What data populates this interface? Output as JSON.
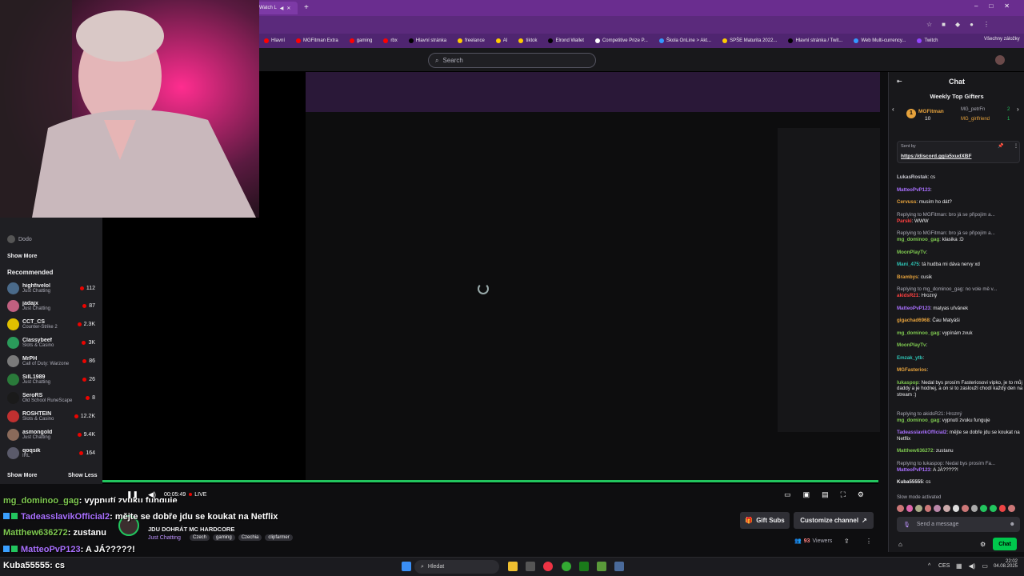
{
  "browser": {
    "tab_title": "Watch L",
    "bookmarks": [
      {
        "label": "Hlavní",
        "color": "#ff0000"
      },
      {
        "label": "MGFitman Extra",
        "color": "#ff0000"
      },
      {
        "label": "gaming",
        "color": "#ff0000"
      },
      {
        "label": "rbx",
        "color": "#ff0000"
      },
      {
        "label": "Hlavní stránka",
        "color": "#000000"
      },
      {
        "label": "freelance",
        "color": "#ffcc00"
      },
      {
        "label": "AI",
        "color": "#ffcc00"
      },
      {
        "label": "tiktok",
        "color": "#ffcc00"
      },
      {
        "label": "Elrond Wallet",
        "color": "#000000"
      },
      {
        "label": "Competitive Prize P...",
        "color": "#ffffff"
      },
      {
        "label": "Škola OnLine > Akt...",
        "color": "#3399ff"
      },
      {
        "label": "SPŠE Maturita 2022...",
        "color": "#ffcc00"
      },
      {
        "label": "Hlavní stránka / Twit...",
        "color": "#000000"
      },
      {
        "label": "Web Multi-currency...",
        "color": "#3399ff"
      },
      {
        "label": "Twitch",
        "color": "#9146ff"
      }
    ],
    "all_bookmarks": "Všechny záložky"
  },
  "topnav": {
    "search_placeholder": "Search"
  },
  "sidebar": {
    "channels_top": [
      {
        "name": "Dodo"
      }
    ],
    "show_more": "Show More",
    "recommended_title": "Recommended",
    "recommended": [
      {
        "name": "highfivelol",
        "game": "Just Chatting",
        "viewers": "112",
        "color": "#4a6a8a"
      },
      {
        "name": "jadajx",
        "game": "Just Chatting",
        "viewers": "87",
        "color": "#c06080"
      },
      {
        "name": "CCT_CS",
        "game": "Counter-Strike 2",
        "viewers": "2.3K",
        "color": "#e0c000"
      },
      {
        "name": "Classybeef",
        "game": "Slots & Casino",
        "viewers": "3K",
        "color": "#2a9a5a"
      },
      {
        "name": "MrPH",
        "game": "Call of Duty: Warzone",
        "viewers": "86",
        "color": "#7a7a7a"
      },
      {
        "name": "SilL1989",
        "game": "Just Chatting",
        "viewers": "26",
        "color": "#2a7a3a"
      },
      {
        "name": "SeroRS",
        "game": "Old School RuneScape",
        "viewers": "8",
        "color": "#1a1a1a"
      },
      {
        "name": "ROSHTEIN",
        "game": "Slots & Casino",
        "viewers": "12.2K",
        "color": "#c03030"
      },
      {
        "name": "asmongold",
        "game": "Just Chatting",
        "viewers": "9.4K",
        "color": "#8a6a5a"
      },
      {
        "name": "qoqsik",
        "game": "IRL",
        "viewers": "164",
        "color": "#5a5a6a"
      }
    ],
    "show_more_2": "Show More",
    "show_less": "Show Less"
  },
  "player": {
    "time": "00:05:49",
    "live": "LIVE"
  },
  "overlay_chat": [
    {
      "user": "mg_dominoo_gag",
      "text": ": vypnutí zvuku funguje",
      "color": "#7ec850"
    },
    {
      "user": "TadeasslavikOfficial2",
      "text": ": mějte se dobře jdu se koukat na Netflix",
      "color": "#a970ff"
    },
    {
      "user": "Matthew636272",
      "text": ": zustanu",
      "color": "#7ec850"
    },
    {
      "user": "MatteoPvP123",
      "text": ": A JÁ?????!",
      "color": "#a970ff"
    },
    {
      "user": "Kuba55555",
      "text": ": cs",
      "color": "#ffffff"
    }
  ],
  "stream": {
    "title": "JDU DOHRÁT MC HARDCORE",
    "category": "Just Chatting",
    "tags": [
      "Czech",
      "gaming",
      "Czechia",
      "clipfarmer"
    ],
    "gift_subs": "Gift Subs",
    "customize": "Customize channel",
    "viewers_count": "93",
    "viewers_label": "Viewers"
  },
  "chat": {
    "title": "Chat",
    "top_gifters_title": "Weekly Top Gifters",
    "gifters": [
      {
        "name": "MGFitman",
        "count": "10"
      },
      {
        "name": "MG_petrFn",
        "count": "2"
      },
      {
        "name": "MG_girlfriend",
        "count": "1"
      }
    ],
    "pinned_by": "Sent by",
    "pinned_link": "https://discord.gg/a5xudXBF",
    "messages": [
      {
        "user": "LukasRostak",
        "text": ": cs",
        "color": "#c9c9d1"
      },
      {
        "user": "MatteoPvP123",
        "text": ":",
        "color": "#a970ff"
      },
      {
        "user": "Cervuss",
        "text": ": musím ho dát?",
        "color": "#e6a23c"
      },
      {
        "reply": "Replying to MGFitman: bro já se připojím a..."
      },
      {
        "user": "Parski",
        "text": ": WWW",
        "color": "#ff4040"
      },
      {
        "reply": "Replying to MGFitman: bro já se připojím a..."
      },
      {
        "user": "mg_dominoo_gag",
        "text": ": klasika :D",
        "color": "#7ec850"
      },
      {
        "user": "MoonPlayTv",
        "text": ":",
        "color": "#7ec850"
      },
      {
        "user": "Mani_475",
        "text": ": tá hudba mi dáva nervy xd",
        "color": "#2ec4b6"
      },
      {
        "user": "Brambys",
        "text": ": cusik",
        "color": "#e6a23c"
      },
      {
        "reply": "Replying to mg_dominoo_gag: no vole mě v..."
      },
      {
        "user": "akidsR21",
        "text": ": Hrozný",
        "color": "#ff4040"
      },
      {
        "user": "MatteoPvP123",
        "text": ": matyas uřvánek",
        "color": "#a970ff"
      },
      {
        "user": "gigachad6968",
        "text": ": Čau Matyáši",
        "color": "#e6a23c"
      },
      {
        "user": "mg_dominoo_gag",
        "text": ": vypínám zvuk",
        "color": "#7ec850"
      },
      {
        "user": "MoonPlayTv",
        "text": ":",
        "color": "#7ec850"
      },
      {
        "user": "Emzak_ytb",
        "text": ":",
        "color": "#2ec4b6"
      },
      {
        "user": "MGFasterios",
        "text": ":",
        "color": "#e6a23c"
      },
      {
        "user": "lukaspop",
        "text": ": Nedal bys prosím Fasteriosovi vipko, je to můj daddy a je hodnej, a on si to zaslouží chodí každý den na stream :)",
        "color": "#7ec850"
      },
      {
        "reply": "Replying to akidsR21: Hrozný"
      },
      {
        "user": "mg_dominoo_gag",
        "text": ": vypnutí zvuku funguje",
        "color": "#7ec850"
      },
      {
        "user": "TadeasslavikOfficial2",
        "text": ": mějte se dobře jdu se koukat na Netflix",
        "color": "#a970ff"
      },
      {
        "user": "Matthew636272",
        "text": ": zustanu",
        "color": "#7ec850"
      },
      {
        "reply": "Replying to lukaspop: Nedal bys prosím Fa..."
      },
      {
        "user": "MatteoPvP123",
        "text": ": A JÁ?????!",
        "color": "#a970ff"
      },
      {
        "user": "Kuba55555",
        "text": ": cs",
        "color": "#efeff1"
      }
    ],
    "slow_mode": "Slow mode activated",
    "input_placeholder": "Send a message",
    "chat_button": "Chat"
  },
  "taskbar": {
    "search": "Hledat",
    "lang": "CES",
    "time": "22:02",
    "date": "04.08.2025"
  }
}
